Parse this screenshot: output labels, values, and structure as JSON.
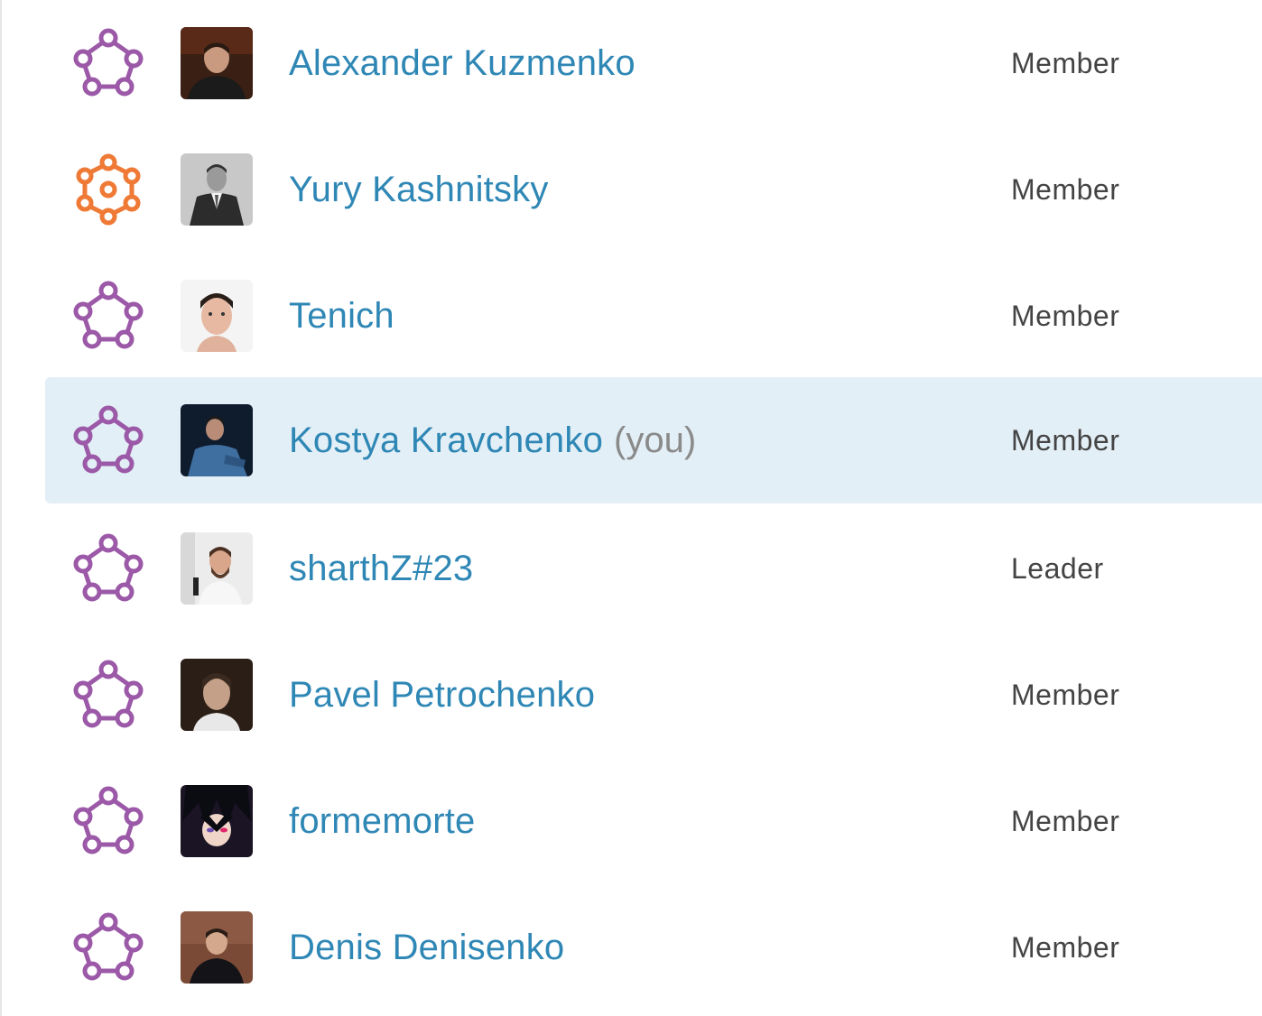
{
  "members": [
    {
      "name": "Alexander Kuzmenko",
      "you": "",
      "role": "Member",
      "tier_icon": "contributor-tier-icon",
      "tier_color": "#9b59a8"
    },
    {
      "name": "Yury Kashnitsky",
      "you": "",
      "role": "Member",
      "tier_icon": "master-tier-icon",
      "tier_color": "#ef7a36"
    },
    {
      "name": "Tenich",
      "you": "",
      "role": "Member",
      "tier_icon": "contributor-tier-icon",
      "tier_color": "#9b59a8"
    },
    {
      "name": "Kostya Kravchenko",
      "you": "(you)",
      "role": "Member",
      "tier_icon": "contributor-tier-icon",
      "tier_color": "#9b59a8"
    },
    {
      "name": "sharthZ#23",
      "you": "",
      "role": "Leader",
      "tier_icon": "contributor-tier-icon",
      "tier_color": "#9b59a8"
    },
    {
      "name": "Pavel Petrochenko",
      "you": "",
      "role": "Member",
      "tier_icon": "contributor-tier-icon",
      "tier_color": "#9b59a8"
    },
    {
      "name": "formemorte",
      "you": "",
      "role": "Member",
      "tier_icon": "contributor-tier-icon",
      "tier_color": "#9b59a8"
    },
    {
      "name": "Denis Denisenko",
      "you": "",
      "role": "Member",
      "tier_icon": "contributor-tier-icon",
      "tier_color": "#9b59a8"
    }
  ],
  "colors": {
    "name_link": "#2f87b5",
    "you_suffix": "#8a8a8a",
    "role_text": "#444444",
    "highlight_row": "#e3eff6"
  }
}
